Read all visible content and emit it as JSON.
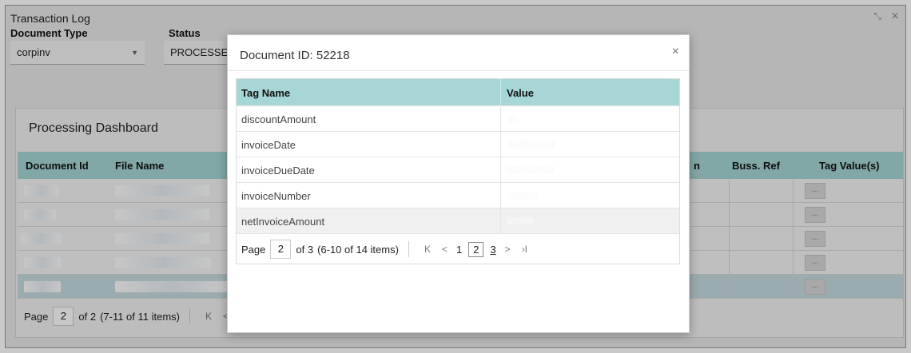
{
  "window": {
    "title": "Transaction Log",
    "controls": [
      "minimize-icon",
      "close-icon"
    ]
  },
  "filters": {
    "document_type": {
      "label": "Document Type",
      "value": "corpinv"
    },
    "status": {
      "label": "Status",
      "value": "PROCESSED"
    }
  },
  "dashboard": {
    "title": "Processing Dashboard",
    "columns": [
      "Document Id",
      "File Name",
      "n",
      "Buss. Ref",
      "Tag Value(s)"
    ],
    "row_count": 5,
    "selected_row": 5,
    "tag_button_label": "...",
    "pager": {
      "page_label": "Page",
      "page": "2",
      "of_label": "of 2",
      "items": "(7-11 of 11 items)"
    }
  },
  "modal": {
    "title": "Document ID: 52218",
    "close_label": "×",
    "columns": {
      "tag_name": "Tag Name",
      "value": "Value"
    },
    "rows": [
      {
        "tag": "discountAmount",
        "value": "10"
      },
      {
        "tag": "invoiceDate",
        "value": "15/09/2018"
      },
      {
        "tag": "invoiceDueDate",
        "value": "20/10/2018"
      },
      {
        "tag": "invoiceNumber",
        "value": "762207"
      },
      {
        "tag": "netInvoiceAmount",
        "value": "52000"
      }
    ],
    "pager": {
      "page_label": "Page",
      "page": "2",
      "of_label": "of 3",
      "items": "(6-10 of 14 items)",
      "first": "K",
      "prev": "<",
      "pages": [
        "1",
        "2",
        "3"
      ],
      "next": ">",
      "last": "›I"
    }
  },
  "colors": {
    "header_teal": "#a7d6d6",
    "selected_row": "#c7dde3"
  }
}
